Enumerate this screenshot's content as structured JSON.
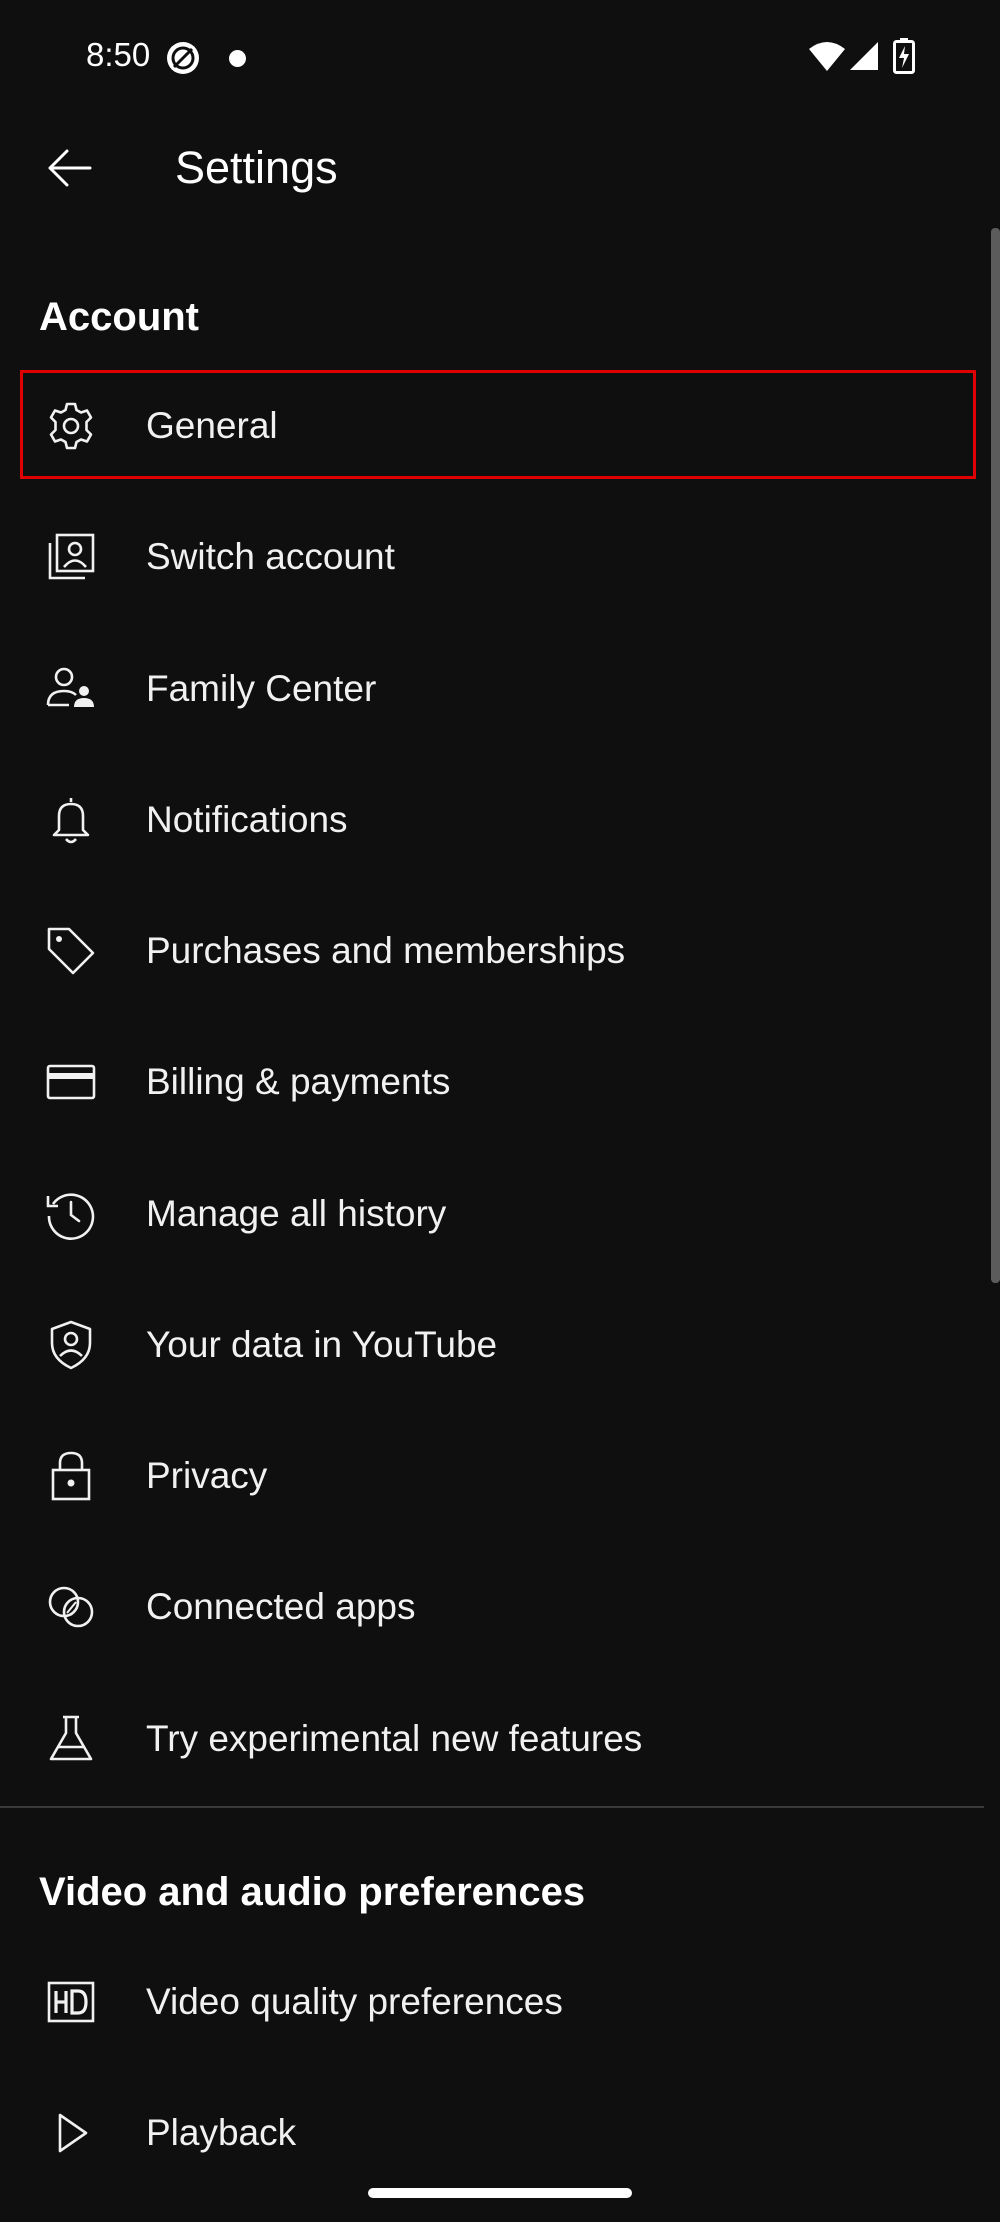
{
  "status_bar": {
    "time": "8:50",
    "icons": [
      "vpn-icon",
      "notification-dot",
      "wifi-icon",
      "signal-icon",
      "battery-charging-icon"
    ]
  },
  "app_bar": {
    "back_icon": "arrow-left-icon",
    "title": "Settings"
  },
  "sections": [
    {
      "header": "Account",
      "items": [
        {
          "label": "General",
          "icon": "gear-icon",
          "highlighted": true
        },
        {
          "label": "Switch account",
          "icon": "switch-account-icon"
        },
        {
          "label": "Family Center",
          "icon": "family-icon"
        },
        {
          "label": "Notifications",
          "icon": "bell-icon"
        },
        {
          "label": "Purchases and memberships",
          "icon": "tag-icon"
        },
        {
          "label": "Billing & payments",
          "icon": "credit-card-icon"
        },
        {
          "label": "Manage all history",
          "icon": "history-icon"
        },
        {
          "label": "Your data in YouTube",
          "icon": "shield-person-icon"
        },
        {
          "label": "Privacy",
          "icon": "lock-icon"
        },
        {
          "label": "Connected apps",
          "icon": "connected-circles-icon"
        },
        {
          "label": "Try experimental new features",
          "icon": "flask-icon"
        }
      ]
    },
    {
      "header": "Video and audio preferences",
      "items": [
        {
          "label": "Video quality preferences",
          "icon": "hd-icon"
        },
        {
          "label": "Playback",
          "icon": "play-icon"
        }
      ]
    }
  ],
  "colors": {
    "background": "#0f0f0f",
    "text": "#f1f1f1",
    "highlight": "#e00000"
  }
}
